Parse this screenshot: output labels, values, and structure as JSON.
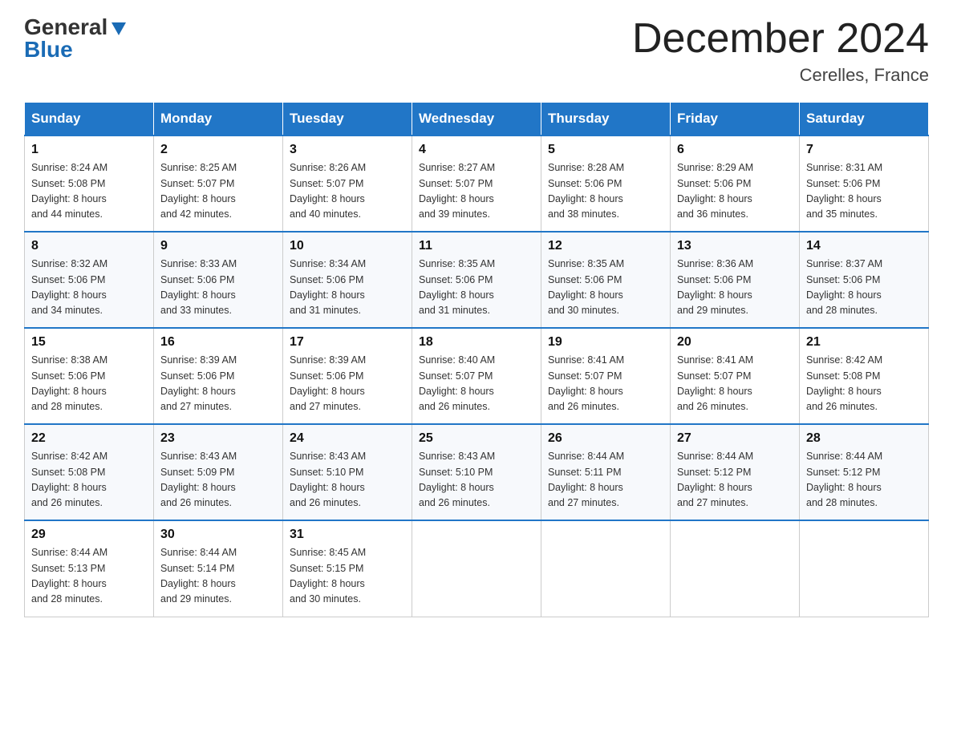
{
  "header": {
    "logo_general": "General",
    "logo_blue": "Blue",
    "month_title": "December 2024",
    "location": "Cerelles, France"
  },
  "weekdays": [
    "Sunday",
    "Monday",
    "Tuesday",
    "Wednesday",
    "Thursday",
    "Friday",
    "Saturday"
  ],
  "weeks": [
    [
      {
        "day": "1",
        "sunrise": "8:24 AM",
        "sunset": "5:08 PM",
        "daylight": "8 hours and 44 minutes."
      },
      {
        "day": "2",
        "sunrise": "8:25 AM",
        "sunset": "5:07 PM",
        "daylight": "8 hours and 42 minutes."
      },
      {
        "day": "3",
        "sunrise": "8:26 AM",
        "sunset": "5:07 PM",
        "daylight": "8 hours and 40 minutes."
      },
      {
        "day": "4",
        "sunrise": "8:27 AM",
        "sunset": "5:07 PM",
        "daylight": "8 hours and 39 minutes."
      },
      {
        "day": "5",
        "sunrise": "8:28 AM",
        "sunset": "5:06 PM",
        "daylight": "8 hours and 38 minutes."
      },
      {
        "day": "6",
        "sunrise": "8:29 AM",
        "sunset": "5:06 PM",
        "daylight": "8 hours and 36 minutes."
      },
      {
        "day": "7",
        "sunrise": "8:31 AM",
        "sunset": "5:06 PM",
        "daylight": "8 hours and 35 minutes."
      }
    ],
    [
      {
        "day": "8",
        "sunrise": "8:32 AM",
        "sunset": "5:06 PM",
        "daylight": "8 hours and 34 minutes."
      },
      {
        "day": "9",
        "sunrise": "8:33 AM",
        "sunset": "5:06 PM",
        "daylight": "8 hours and 33 minutes."
      },
      {
        "day": "10",
        "sunrise": "8:34 AM",
        "sunset": "5:06 PM",
        "daylight": "8 hours and 31 minutes."
      },
      {
        "day": "11",
        "sunrise": "8:35 AM",
        "sunset": "5:06 PM",
        "daylight": "8 hours and 31 minutes."
      },
      {
        "day": "12",
        "sunrise": "8:35 AM",
        "sunset": "5:06 PM",
        "daylight": "8 hours and 30 minutes."
      },
      {
        "day": "13",
        "sunrise": "8:36 AM",
        "sunset": "5:06 PM",
        "daylight": "8 hours and 29 minutes."
      },
      {
        "day": "14",
        "sunrise": "8:37 AM",
        "sunset": "5:06 PM",
        "daylight": "8 hours and 28 minutes."
      }
    ],
    [
      {
        "day": "15",
        "sunrise": "8:38 AM",
        "sunset": "5:06 PM",
        "daylight": "8 hours and 28 minutes."
      },
      {
        "day": "16",
        "sunrise": "8:39 AM",
        "sunset": "5:06 PM",
        "daylight": "8 hours and 27 minutes."
      },
      {
        "day": "17",
        "sunrise": "8:39 AM",
        "sunset": "5:06 PM",
        "daylight": "8 hours and 27 minutes."
      },
      {
        "day": "18",
        "sunrise": "8:40 AM",
        "sunset": "5:07 PM",
        "daylight": "8 hours and 26 minutes."
      },
      {
        "day": "19",
        "sunrise": "8:41 AM",
        "sunset": "5:07 PM",
        "daylight": "8 hours and 26 minutes."
      },
      {
        "day": "20",
        "sunrise": "8:41 AM",
        "sunset": "5:07 PM",
        "daylight": "8 hours and 26 minutes."
      },
      {
        "day": "21",
        "sunrise": "8:42 AM",
        "sunset": "5:08 PM",
        "daylight": "8 hours and 26 minutes."
      }
    ],
    [
      {
        "day": "22",
        "sunrise": "8:42 AM",
        "sunset": "5:08 PM",
        "daylight": "8 hours and 26 minutes."
      },
      {
        "day": "23",
        "sunrise": "8:43 AM",
        "sunset": "5:09 PM",
        "daylight": "8 hours and 26 minutes."
      },
      {
        "day": "24",
        "sunrise": "8:43 AM",
        "sunset": "5:10 PM",
        "daylight": "8 hours and 26 minutes."
      },
      {
        "day": "25",
        "sunrise": "8:43 AM",
        "sunset": "5:10 PM",
        "daylight": "8 hours and 26 minutes."
      },
      {
        "day": "26",
        "sunrise": "8:44 AM",
        "sunset": "5:11 PM",
        "daylight": "8 hours and 27 minutes."
      },
      {
        "day": "27",
        "sunrise": "8:44 AM",
        "sunset": "5:12 PM",
        "daylight": "8 hours and 27 minutes."
      },
      {
        "day": "28",
        "sunrise": "8:44 AM",
        "sunset": "5:12 PM",
        "daylight": "8 hours and 28 minutes."
      }
    ],
    [
      {
        "day": "29",
        "sunrise": "8:44 AM",
        "sunset": "5:13 PM",
        "daylight": "8 hours and 28 minutes."
      },
      {
        "day": "30",
        "sunrise": "8:44 AM",
        "sunset": "5:14 PM",
        "daylight": "8 hours and 29 minutes."
      },
      {
        "day": "31",
        "sunrise": "8:45 AM",
        "sunset": "5:15 PM",
        "daylight": "8 hours and 30 minutes."
      },
      null,
      null,
      null,
      null
    ]
  ],
  "labels": {
    "sunrise": "Sunrise:",
    "sunset": "Sunset:",
    "daylight": "Daylight:"
  }
}
